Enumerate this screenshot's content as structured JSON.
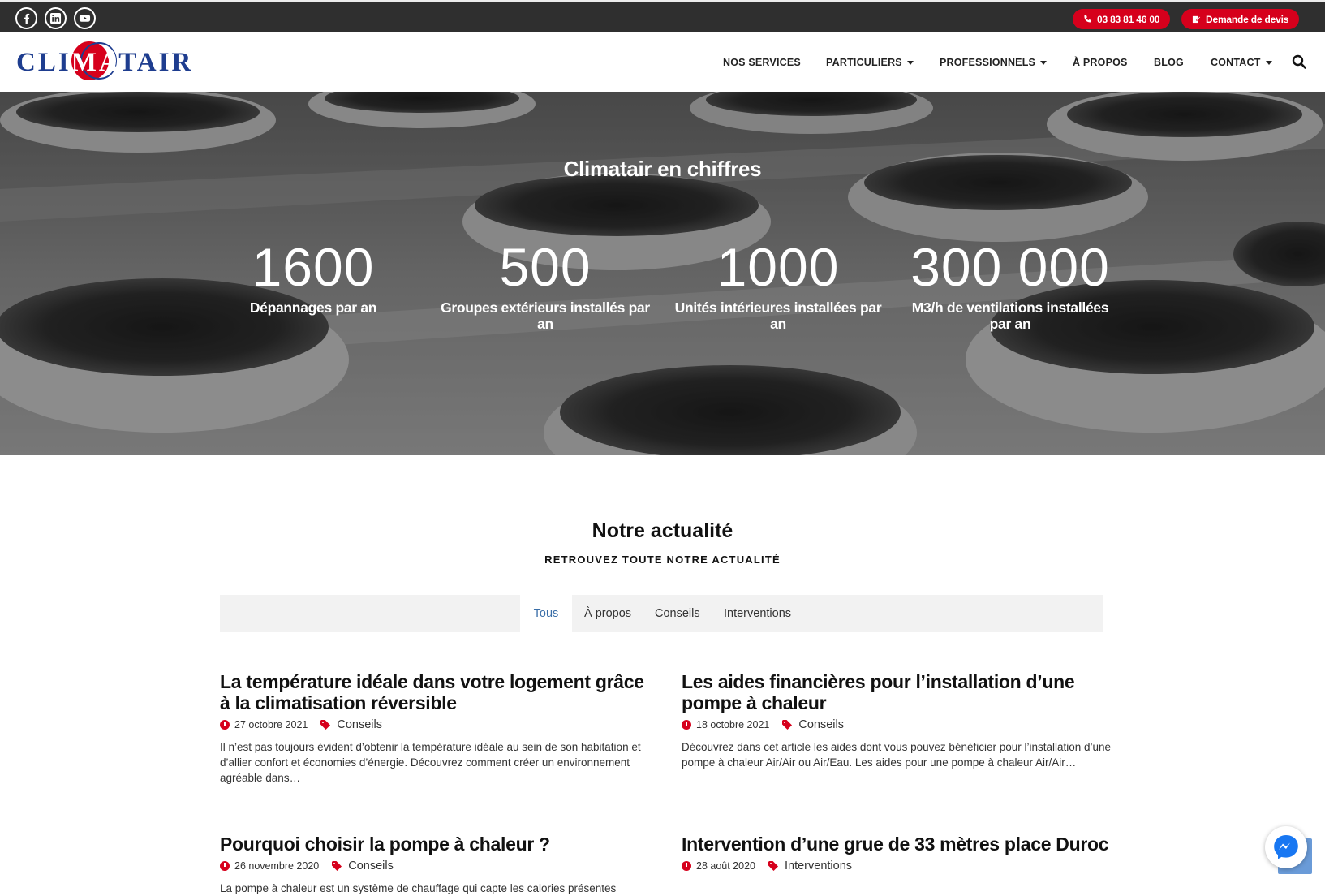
{
  "topbar": {
    "phone": "03 83 81 46 00",
    "quote": "Demande de devis",
    "social": [
      "facebook-icon",
      "linkedin-icon",
      "youtube-icon"
    ]
  },
  "header": {
    "logo": "CLIMATAIR",
    "nav": [
      {
        "label": "NOS SERVICES",
        "dropdown": false
      },
      {
        "label": "PARTICULIERS",
        "dropdown": true
      },
      {
        "label": "PROFESSIONNELS",
        "dropdown": true
      },
      {
        "label": "À PROPOS",
        "dropdown": false
      },
      {
        "label": "BLOG",
        "dropdown": false
      },
      {
        "label": "CONTACT",
        "dropdown": true
      }
    ]
  },
  "hero": {
    "title": "Climatair en chiffres",
    "stats": [
      {
        "num": "1600",
        "label": "Dépannages par an"
      },
      {
        "num": "500",
        "label": "Groupes extérieurs installés par an"
      },
      {
        "num": "1000",
        "label": "Unités intérieures installées par an"
      },
      {
        "num": "300 000",
        "label": "M3/h de ventilations installées par an"
      }
    ]
  },
  "news": {
    "title": "Notre actualité",
    "subtitle": "RETROUVEZ TOUTE NOTRE ACTUALITÉ",
    "filters": [
      "Tous",
      "À propos",
      "Conseils",
      "Interventions"
    ],
    "active_filter": "Tous",
    "posts": [
      {
        "title": "La température idéale dans votre logement grâce à la climatisation réversible",
        "date": "27 octobre 2021",
        "category": "Conseils",
        "excerpt": "Il n’est pas toujours évident d’obtenir la température idéale au sein de son habitation et d’allier confort et économies d’énergie. Découvrez comment créer un environnement agréable dans…"
      },
      {
        "title": "Les aides financières pour l’installation d’une pompe à chaleur",
        "date": "18 octobre 2021",
        "category": "Conseils",
        "excerpt": "Découvrez dans cet article les aides dont vous pouvez bénéficier pour l’installation d’une pompe à chaleur Air/Air ou Air/Eau. Les aides pour une pompe à chaleur Air/Air…"
      },
      {
        "title": "Pourquoi choisir la pompe à chaleur ?",
        "date": "26 novembre 2020",
        "category": "Conseils",
        "excerpt": "La pompe à chaleur est un système de chauffage qui capte les calories présentes"
      },
      {
        "title": "Intervention d’une grue de 33 mètres place Duroc",
        "date": "28 août 2020",
        "category": "Interventions",
        "excerpt": ""
      }
    ]
  },
  "colors": {
    "accent": "#d6001c",
    "topbar": "#2f2f2f",
    "brand_blue": "#1e3d8f",
    "filter_active": "#3a6ea8"
  }
}
